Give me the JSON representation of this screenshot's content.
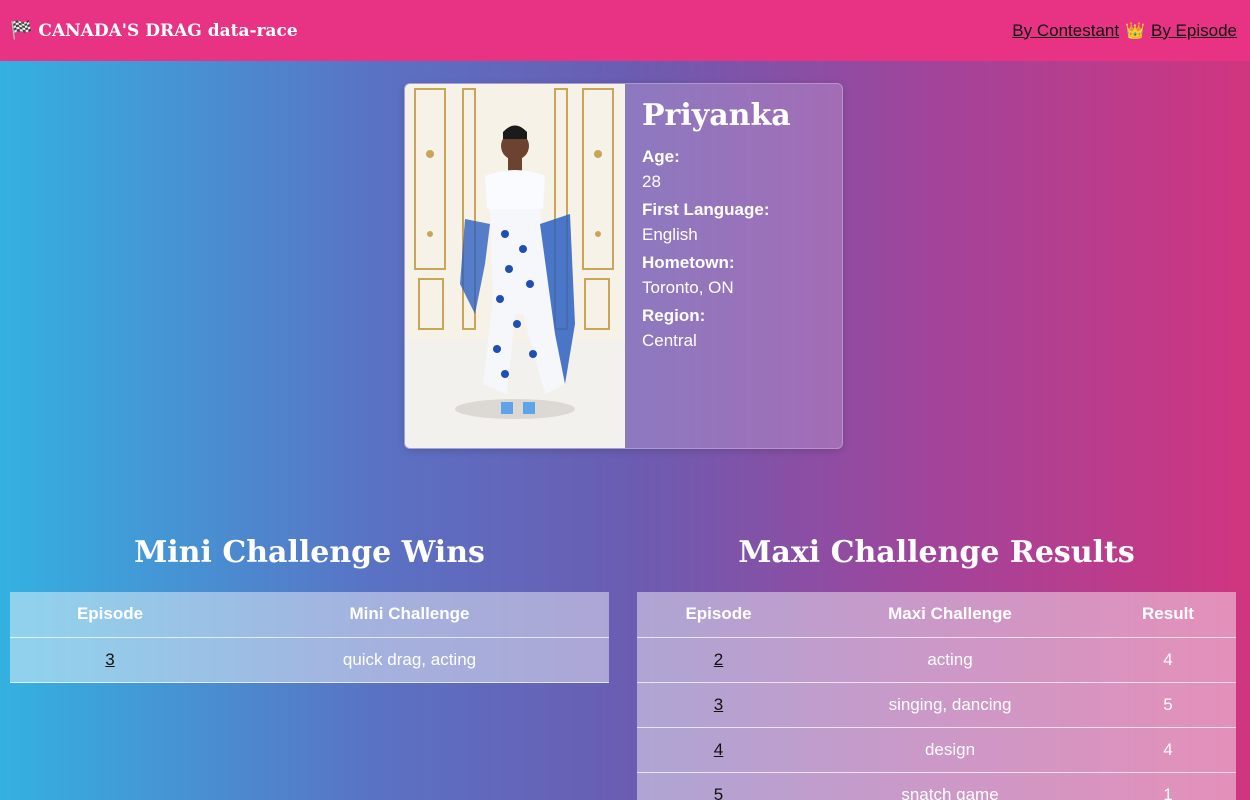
{
  "header": {
    "brand": "CANADA'S DRAG data-race",
    "nav": {
      "by_contestant": "By Contestant",
      "separator_icon": "👑",
      "by_episode": "By Episode"
    }
  },
  "contestant": {
    "name": "Priyanka",
    "fields": [
      {
        "label": "Age:",
        "value": "28"
      },
      {
        "label": "First Language:",
        "value": "English"
      },
      {
        "label": "Hometown:",
        "value": "Toronto, ON"
      },
      {
        "label": "Region:",
        "value": "Central"
      }
    ]
  },
  "mini": {
    "title": "Mini Challenge Wins",
    "headers": [
      "Episode",
      "Mini Challenge"
    ],
    "rows": [
      {
        "episode": "3",
        "challenge": "quick drag, acting"
      }
    ]
  },
  "maxi": {
    "title": "Maxi Challenge Results",
    "headers": [
      "Episode",
      "Maxi Challenge",
      "Result"
    ],
    "rows": [
      {
        "episode": "2",
        "challenge": "acting",
        "result": "4"
      },
      {
        "episode": "3",
        "challenge": "singing, dancing",
        "result": "5"
      },
      {
        "episode": "4",
        "challenge": "design",
        "result": "4"
      },
      {
        "episode": "5",
        "challenge": "snatch game",
        "result": "1"
      }
    ]
  }
}
